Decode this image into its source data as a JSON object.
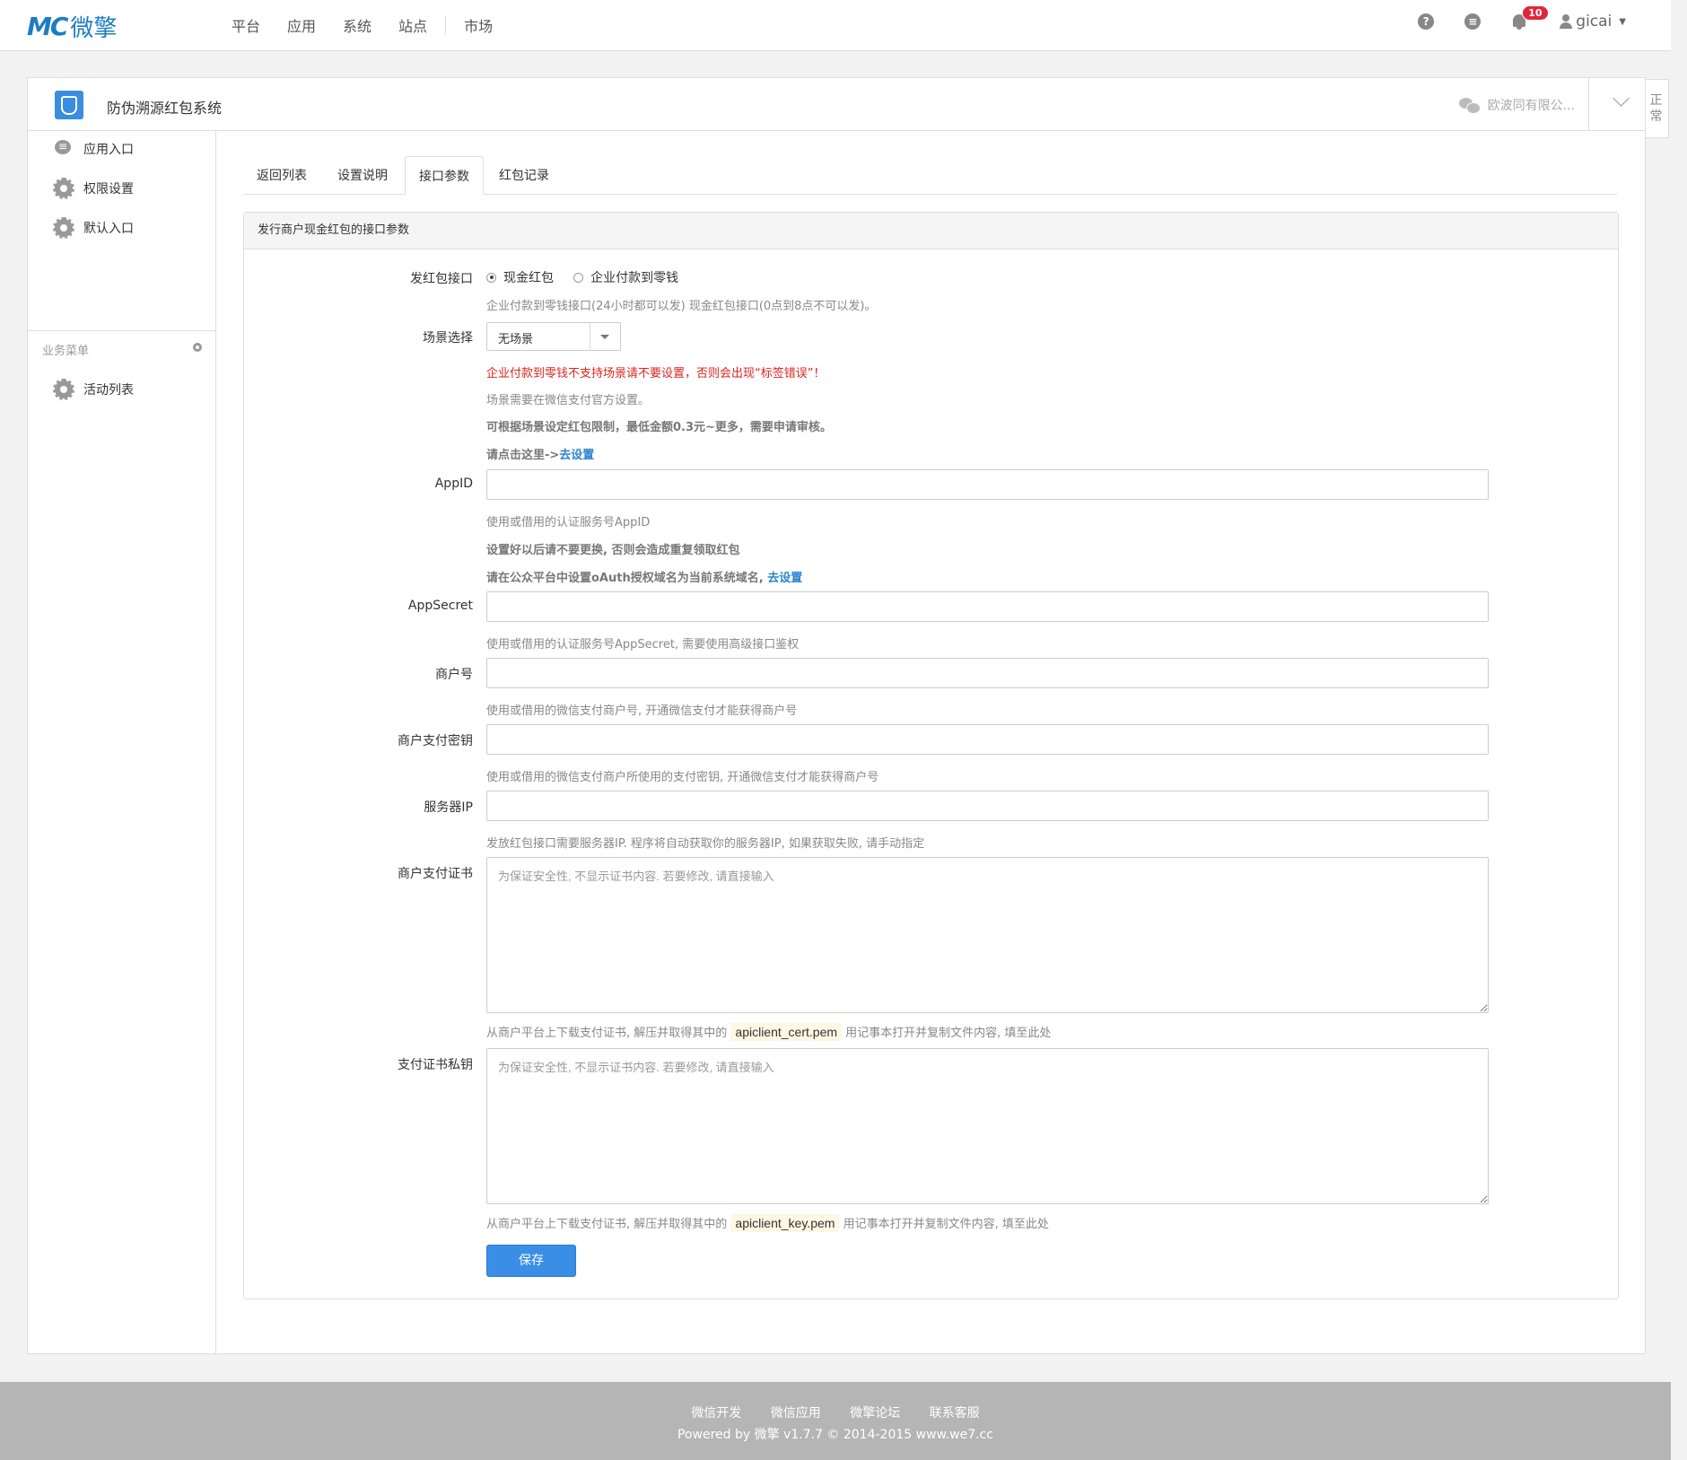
{
  "topbar": {
    "logo_mark": "MC",
    "logo_text": "微擎",
    "nav": [
      "平台",
      "应用",
      "系统",
      "站点",
      "市场"
    ],
    "help_icon": "question-circle-icon",
    "msg_icon": "comment-icon",
    "notification_count": "10",
    "username": "gicai"
  },
  "app": {
    "title": "防伪溯源红包系统",
    "account": "欧波同有限公...",
    "side_tab": "正常"
  },
  "sidebar": {
    "items": [
      "应用入口",
      "权限设置",
      "默认入口"
    ],
    "group_title": "业务菜单",
    "group_items": [
      "活动列表"
    ]
  },
  "tabs": [
    "返回列表",
    "设置说明",
    "接口参数",
    "红包记录"
  ],
  "card": {
    "title": "发行商户现金红包的接口参数"
  },
  "form": {
    "iface_label": "发红包接口",
    "iface_opt1": "现金红包",
    "iface_opt2": "企业付款到零钱",
    "iface_selected": "现金红包",
    "iface_help": "企业付款到零钱接口(24小时都可以发) 现金红包接口(0点到8点不可以发)。",
    "scene_label": "场景选择",
    "scene_value": "无场景",
    "scene_err": "企业付款到零钱不支持场景请不要设置，否则会出现“标签错误”！",
    "scene_help1": "场景需要在微信支付官方设置。",
    "scene_help2": "可根据场景设定红包限制，最低金额0.3元~更多，需要申请审核。",
    "scene_help3": "请点击这里->",
    "scene_link": "去设置",
    "appid_label": "AppID",
    "appid_help1": "使用或借用的认证服务号AppID",
    "appid_help2": "设置好以后请不要更换, 否则会造成重复领取红包",
    "appid_help3": "请在公众平台中设置oAuth授权域名为当前系统域名, ",
    "appid_link": "去设置",
    "secret_label": "AppSecret",
    "secret_help": "使用或借用的认证服务号AppSecret, 需要使用高级接口鉴权",
    "mch_label": "商户号",
    "mch_help": "使用或借用的微信支付商户号, 开通微信支付才能获得商户号",
    "key_label": "商户支付密钥",
    "key_help": "使用或借用的微信支付商户所使用的支付密钥, 开通微信支付才能获得商户号",
    "ip_label": "服务器IP",
    "ip_help": "发放红包接口需要服务器IP. 程序将自动获取你的服务器IP, 如果获取失败, 请手动指定",
    "cert_label": "商户支付证书",
    "cert_placeholder": "为保证安全性, 不显示证书内容. 若要修改, 请直接输入",
    "cert_help_pre": "从商户平台上下载支付证书, 解压并取得其中的",
    "cert_file": "apiclient_cert.pem",
    "cert_help_post": "用记事本打开并复制文件内容, 填至此处",
    "pkey_label": "支付证书私钥",
    "pkey_placeholder": "为保证安全性, 不显示证书内容. 若要修改, 请直接输入",
    "pkey_help_pre": "从商户平台上下载支付证书, 解压并取得其中的",
    "pkey_file": "apiclient_key.pem",
    "pkey_help_post": "用记事本打开并复制文件内容, 填至此处",
    "save": "保存"
  },
  "footer": {
    "links": [
      "微信开发",
      "微信应用",
      "微擎论坛",
      "联系客服"
    ],
    "copyright": "Powered by 微擎 v1.7.7 © 2014-2015 www.we7.cc"
  },
  "colors": {
    "brand": "#1e7cc3",
    "primary_button": "#3a8ee6",
    "error": "#d9261c",
    "link": "#2a84d0",
    "badge": "#e0263c",
    "footer": "#b5b5b5"
  }
}
